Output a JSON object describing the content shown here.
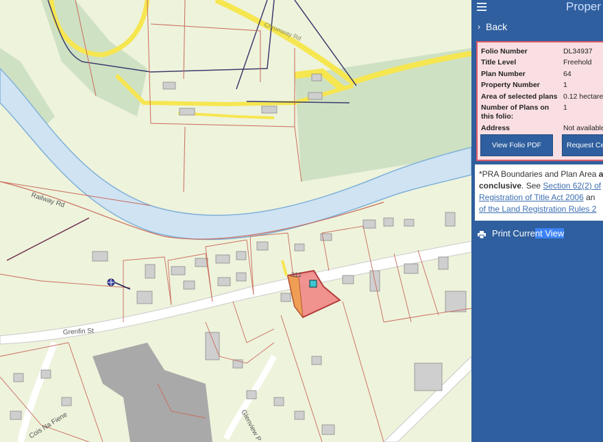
{
  "map": {
    "labels": {
      "railway_rd": "Railway Rd",
      "grenfin_st": "Grenfin St",
      "cois_na_fiene": "Cois Na Fiene",
      "glenview": "Glenview P",
      "plot_no": "312",
      "road_label": "Chromway Rd"
    },
    "colors": {
      "background": "#eef3dc",
      "river": "#cfe3f2",
      "river_edge": "#7fb0d9",
      "forest": "#cfe1c3",
      "yellow_road": "#f6e650",
      "boundary": "#c96a5a",
      "highlight": "#f08080",
      "parcel_edge": "#b33a3a",
      "marker": "#3ec7d1"
    }
  },
  "panel": {
    "title": "Proper",
    "back_label": "Back",
    "folio": {
      "rows": [
        {
          "key": "Folio Number",
          "value": "DL34937"
        },
        {
          "key": "Title Level",
          "value": "Freehold"
        },
        {
          "key": "Plan Number",
          "value": "64"
        },
        {
          "key": "Property Number",
          "value": "1"
        },
        {
          "key": "Area of selected plans",
          "value": "0.12 hectare"
        },
        {
          "key": "Number of Plans on this folio:",
          "value": "1"
        },
        {
          "key": "Address",
          "value": "Not available"
        }
      ],
      "view_pdf_label": "View Folio PDF",
      "request_label": "Request Ce"
    },
    "note": {
      "prefix": "*PRA Boundaries and Plan Area",
      "bold1": "are",
      "bold2": "conclusive",
      "mid": ". See",
      "link1a": "Section 62(2) of",
      "link1b": "Registration of Title Act 2006",
      "tail": "an",
      "link2": "of the Land Registration Rules 2"
    },
    "print": {
      "label_a": "Print Curre",
      "label_b": "nt View"
    },
    "colors": {
      "panel_bg": "#2f5f9e",
      "card_bg": "#f9dfe3",
      "card_border": "#e05a66"
    }
  }
}
